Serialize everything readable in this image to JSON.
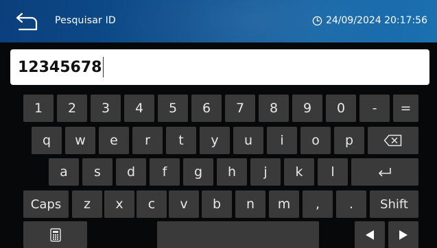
{
  "header": {
    "title": "Pesquisar ID",
    "datetime": "24/09/2024 20:17:56",
    "back_icon": "back-arrow-icon",
    "clock_icon": "clock-icon"
  },
  "search": {
    "value": "12345678"
  },
  "keyboard": {
    "row1": [
      "1",
      "2",
      "3",
      "4",
      "5",
      "6",
      "7",
      "8",
      "9",
      "0",
      "-",
      "="
    ],
    "row2": [
      "q",
      "w",
      "e",
      "r",
      "t",
      "y",
      "u",
      "i",
      "o",
      "p"
    ],
    "row3": [
      "a",
      "s",
      "d",
      "f",
      "g",
      "h",
      "j",
      "k",
      "l"
    ],
    "row4": [
      "z",
      "x",
      "c",
      "v",
      "b",
      "n",
      "m",
      ",",
      "."
    ],
    "caps_label": "Caps",
    "shift_label": "Shift",
    "backspace_icon": "backspace-icon",
    "enter_icon": "enter-icon",
    "keypad_icon": "numeric-keypad-icon",
    "left_icon": "arrow-left-icon",
    "right_icon": "arrow-right-icon"
  },
  "colors": {
    "header_start": "#0a3f7c",
    "header_end": "#1b70b0",
    "key_bg": "#3a3a3a",
    "key_text": "#e8e8e8",
    "background": "#06080a"
  }
}
